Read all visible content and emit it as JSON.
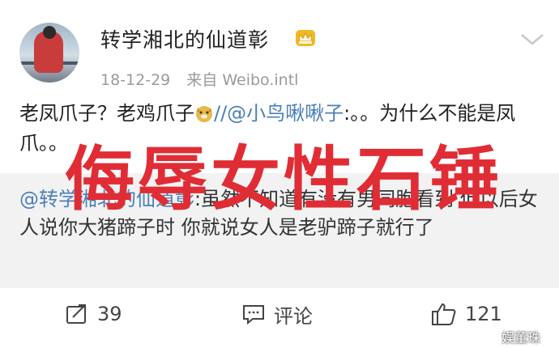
{
  "post": {
    "username": "转学湘北的仙道彰",
    "date": "18-12-29",
    "source": "来自 Weibo.intl",
    "text_before": "老凤爪子？老鸡爪子",
    "mention": "//@小鸟啾啾子",
    "text_after": ":。。为什么不能是凤爪。。"
  },
  "quote": {
    "mention": "@转学湘北的仙道彰",
    "text": ":虽然不知道有没有男同胞看到 但以后女人说你大猪蹄子时 你就说女人是老驴蹄子就行了"
  },
  "overlay": {
    "title": "侮辱女性石锤"
  },
  "actions": {
    "repost_count": "39",
    "comment_label": "评论",
    "like_count": "121"
  },
  "watermark": {
    "text": "娱董珠"
  },
  "colors": {
    "mention": "#4a7fb8",
    "overlay": "#e02d35",
    "quote_bg": "#f2f2f2",
    "crown": "#f1b928"
  }
}
